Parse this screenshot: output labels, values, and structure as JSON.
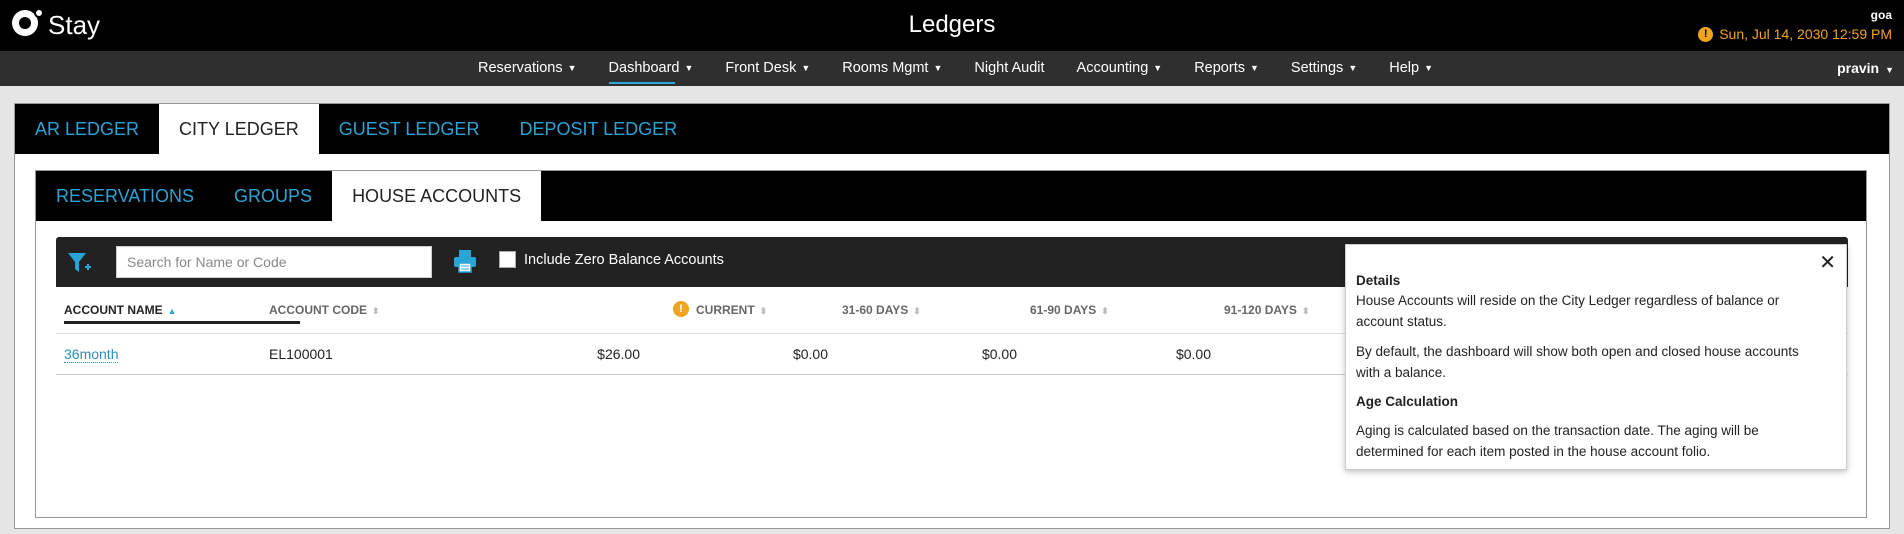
{
  "header": {
    "brand": "Stay",
    "title": "Ledgers",
    "property": "goa",
    "datetime": "Sun, Jul 14, 2030 12:59 PM"
  },
  "nav": {
    "items": [
      {
        "label": "Reservations",
        "dropdown": true
      },
      {
        "label": "Dashboard",
        "dropdown": true,
        "active": true
      },
      {
        "label": "Front Desk",
        "dropdown": true
      },
      {
        "label": "Rooms Mgmt",
        "dropdown": true
      },
      {
        "label": "Night Audit",
        "dropdown": false
      },
      {
        "label": "Accounting",
        "dropdown": true
      },
      {
        "label": "Reports",
        "dropdown": true
      },
      {
        "label": "Settings",
        "dropdown": true
      },
      {
        "label": "Help",
        "dropdown": true
      }
    ],
    "user": "pravin"
  },
  "ledger_tabs": [
    "AR LEDGER",
    "CITY LEDGER",
    "GUEST LEDGER",
    "DEPOSIT LEDGER"
  ],
  "ledger_tab_active": "CITY LEDGER",
  "sub_tabs": [
    "RESERVATIONS",
    "GROUPS",
    "HOUSE ACCOUNTS"
  ],
  "sub_tab_active": "HOUSE ACCOUNTS",
  "toolbar": {
    "search_placeholder": "Search for Name or Code",
    "search_value": "",
    "zero_balance_label": "Include Zero Balance Accounts",
    "zero_balance_checked": false
  },
  "table": {
    "columns": [
      "ACCOUNT NAME",
      "ACCOUNT CODE",
      "CURRENT",
      "31-60 DAYS",
      "61-90 DAYS",
      "91-120 DAYS"
    ],
    "sorted_column": "ACCOUNT NAME",
    "rows": [
      {
        "name": "36month",
        "code": "EL100001",
        "current": "$26.00",
        "d31_60": "$0.00",
        "d61_90": "$0.00",
        "d91_120": "$0.00"
      }
    ]
  },
  "popover": {
    "details_heading": "Details",
    "details_p1": "House Accounts will reside on the City Ledger regardless of balance or account status.",
    "details_p2": "By default, the dashboard will show both open and closed house accounts with a balance.",
    "age_heading": "Age Calculation",
    "age_p": "Aging is calculated based on the transaction date. The aging will be determined for each item posted in the house account folio."
  },
  "colors": {
    "accent": "#2aa3d6",
    "warning": "#f0a420"
  }
}
